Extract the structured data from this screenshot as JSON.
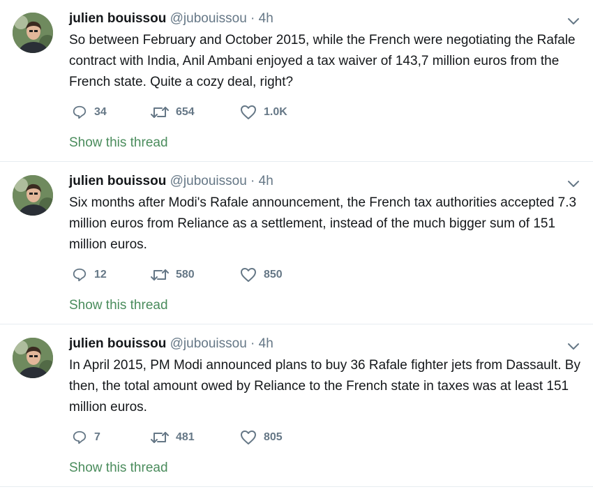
{
  "tweets": [
    {
      "author": "julien bouissou",
      "handle": "@jubouissou",
      "separator": "·",
      "time": "4h",
      "text": "So between February and October 2015, while the French were negotiating the Rafale contract with India, Anil Ambani enjoyed a tax waiver of 143,7 million euros from the French state. Quite a cozy deal, right?",
      "replies": "34",
      "retweets": "654",
      "likes": "1.0K",
      "thread_link": "Show this thread"
    },
    {
      "author": "julien bouissou",
      "handle": "@jubouissou",
      "separator": "·",
      "time": "4h",
      "text": "Six months after Modi's Rafale announcement, the French tax authorities accepted 7.3 million euros from Reliance as a settlement, instead of the much bigger sum of 151 million euros.",
      "replies": "12",
      "retweets": "580",
      "likes": "850",
      "thread_link": "Show this thread"
    },
    {
      "author": "julien bouissou",
      "handle": "@jubouissou",
      "separator": "·",
      "time": "4h",
      "text": "In April 2015, PM Modi announced plans to buy 36 Rafale fighter jets from Dassault. By then, the total amount owed by Reliance to the French state in taxes was at least 151 million euros.",
      "replies": "7",
      "retweets": "481",
      "likes": "805",
      "thread_link": "Show this thread"
    }
  ],
  "icons": {
    "reply": "reply-icon",
    "retweet": "retweet-icon",
    "like": "heart-icon",
    "menu": "chevron-down-icon",
    "avatar": "avatar"
  },
  "colors": {
    "text": "#14171a",
    "secondary": "#657786",
    "thread_link": "#4a8c5c",
    "divider": "#e6ecf0"
  }
}
